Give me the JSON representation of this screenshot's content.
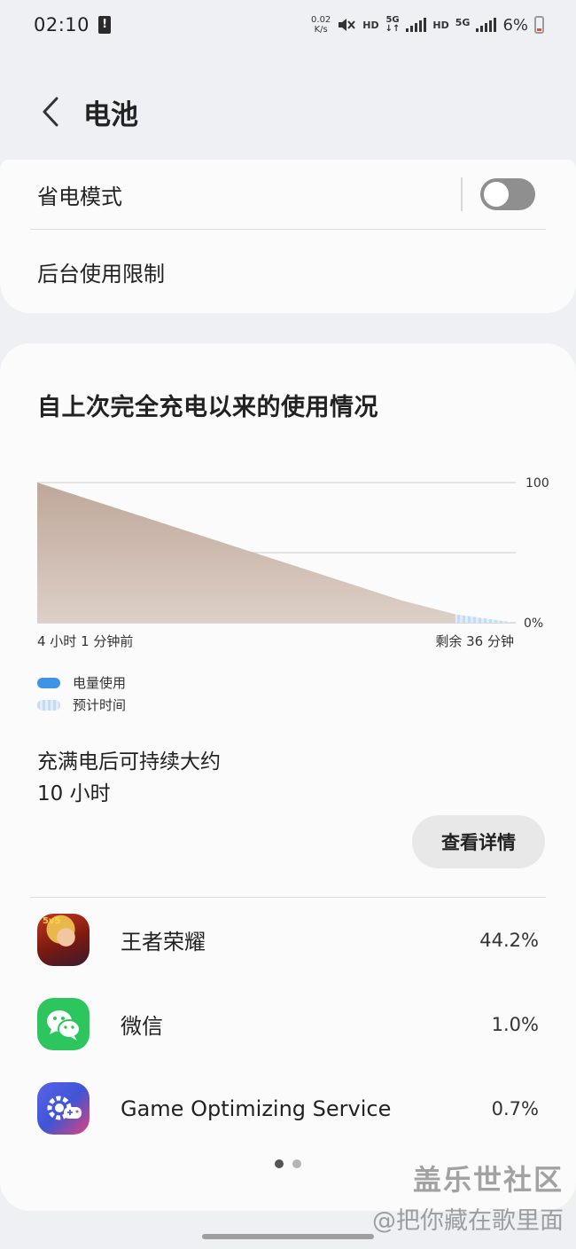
{
  "status_bar": {
    "time": "02:10",
    "warning_icon": "!",
    "net_speed_value": "0.02",
    "net_speed_unit": "K/s",
    "hd1": "HD",
    "five_g1": "5G",
    "five_g1_arrows": "↓↑",
    "hd2": "HD",
    "five_g2": "5G",
    "battery_percent": "6%",
    "icons": [
      "mute-icon",
      "signal-icon",
      "battery-icon"
    ]
  },
  "header": {
    "title": "电池",
    "back_icon": "chevron-left-icon"
  },
  "settings_card": {
    "power_saving_label": "省电模式",
    "power_saving_enabled": false,
    "background_limit_label": "后台使用限制"
  },
  "usage": {
    "title": "自上次完全充电以来的使用情况",
    "time_start_label": "4 小时 1 分钟前",
    "time_remaining_label": "剩余 36 分钟",
    "legend_used": "电量使用",
    "legend_estimated": "预计时间",
    "estimate_line1": "充满电后可持续大约",
    "estimate_line2": "10 小时",
    "details_button": "查看详情"
  },
  "chart_data": {
    "type": "area",
    "ylim": [
      0,
      100
    ],
    "y_ticks": [
      "100",
      "0%"
    ],
    "grid": true,
    "series": [
      {
        "name": "电量使用",
        "x": [
          0,
          0.5,
          1.0,
          1.5,
          2.0,
          2.5,
          3.0,
          3.5,
          4.02
        ],
        "y": [
          100,
          88,
          76,
          64,
          52,
          40,
          28,
          16,
          6
        ]
      },
      {
        "name": "预计时间",
        "x": [
          4.02,
          4.6
        ],
        "y": [
          6,
          0
        ]
      }
    ],
    "colors": {
      "used_top": "#bfa79a",
      "used_bottom": "#ddd0c7",
      "estimated": "#c3dbf4"
    }
  },
  "apps": [
    {
      "name": "王者荣耀",
      "percent": "44.2%",
      "icon": "honor-of-kings-icon"
    },
    {
      "name": "微信",
      "percent": "1.0%",
      "icon": "wechat-icon"
    },
    {
      "name": "Game Optimizing Service",
      "percent": "0.7%",
      "icon": "game-optimizing-icon"
    }
  ],
  "hok_badge": "5v5",
  "pager": {
    "pages": 2,
    "active": 0
  },
  "watermark": {
    "line1": "盖乐世社区",
    "line2": "@把你藏在歌里面"
  }
}
